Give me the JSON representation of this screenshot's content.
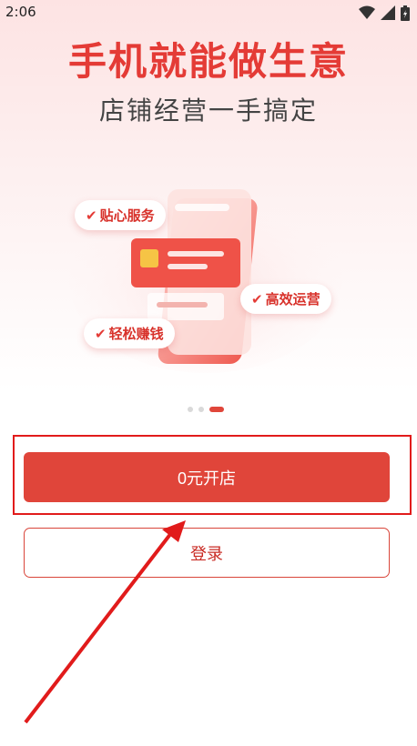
{
  "status_bar": {
    "time": "2:06"
  },
  "hero": {
    "title": "手机就能做生意",
    "subtitle": "店铺经营一手搞定"
  },
  "features": [
    {
      "label": "贴心服务"
    },
    {
      "label": "高效运营"
    },
    {
      "label": "轻松赚钱"
    }
  ],
  "pager": {
    "page_count": 3,
    "active_index": 2
  },
  "actions": {
    "open_store_label": "0元开店",
    "login_label": "登录"
  },
  "colors": {
    "accent": "#e0453a",
    "title": "#e43b36",
    "annotation": "#e11b1b"
  }
}
